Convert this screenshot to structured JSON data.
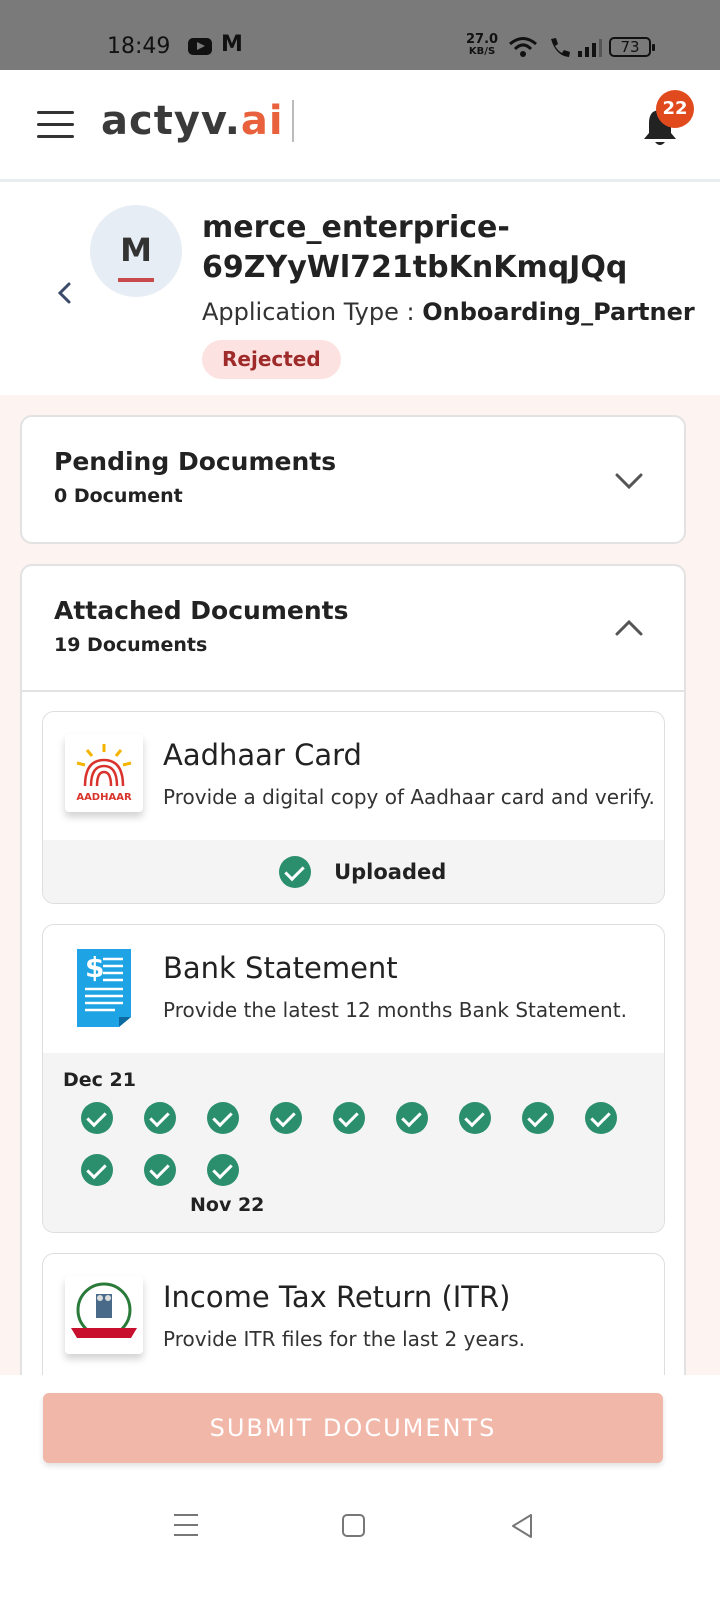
{
  "status_bar": {
    "time": "18:49",
    "mail_icon_text": "M",
    "speed_value": "27.0",
    "speed_unit": "KB/S",
    "battery": "73"
  },
  "header": {
    "logo_main": "actyv.",
    "logo_accent": "ai",
    "notification_count": "22",
    "accent_color": "#e8603c"
  },
  "profile": {
    "avatar_letter": "M",
    "name": "merce_enterprice-69ZYyWl721tbKnKmqJQq",
    "app_type_label": "Application Type :",
    "app_type_value": "Onboarding_Partner",
    "status": "Rejected"
  },
  "pending": {
    "title": "Pending Documents",
    "count": "0 Document",
    "expanded": false
  },
  "attached": {
    "title": "Attached Documents",
    "count": "19 Documents",
    "expanded": true
  },
  "documents": [
    {
      "icon": "aadhaar-icon",
      "icon_text": "AADHAAR",
      "title": "Aadhaar Card",
      "description": "Provide a digital copy of Aadhaar card and verify.",
      "status": "Uploaded"
    },
    {
      "icon": "bank-statement-icon",
      "title": "Bank Statement",
      "description": "Provide the latest 12 months Bank Statement.",
      "start_month": "Dec 21",
      "end_month": "Nov 22",
      "months_uploaded": 12
    },
    {
      "icon": "income-tax-icon",
      "title": "Income Tax Return (ITR)",
      "description": "Provide ITR files for the last 2 years."
    }
  ],
  "submit_label": "SUBMIT DOCUMENTS"
}
